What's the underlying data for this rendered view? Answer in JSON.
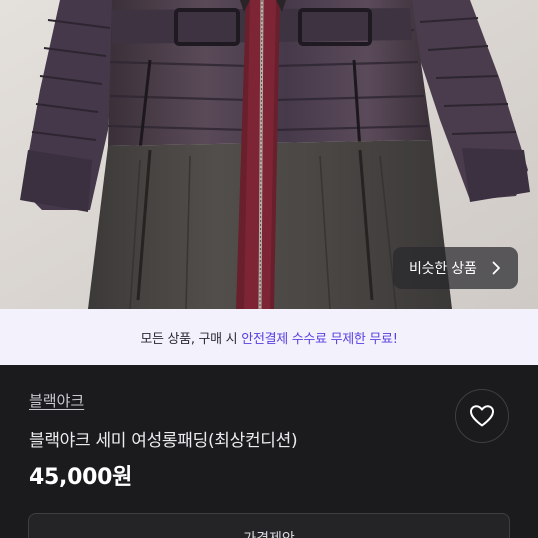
{
  "photo": {
    "alt_subject": "",
    "similar_button": {
      "label": "비슷한 상품",
      "icon": "chevron-right-icon"
    }
  },
  "promo": {
    "lead": "모든 상품, 구매 시",
    "highlight": "안전결제 수수료 무제한 무료!",
    "highlight_color": "#5a3fe0"
  },
  "product": {
    "brand": "블랙야크",
    "title": "블랙야크 세미 여성롱패딩(최상컨디션)",
    "price": "45,000원",
    "like_icon": "heart-icon",
    "offer_button": "가격제안"
  }
}
